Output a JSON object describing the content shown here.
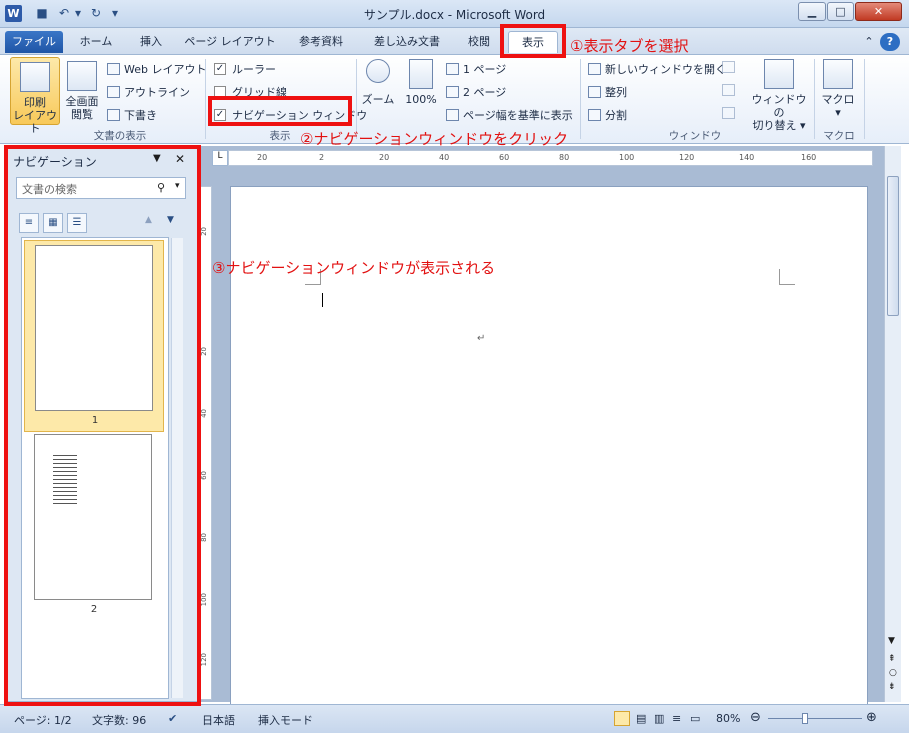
{
  "window": {
    "title": "サンプル.docx - Microsoft Word"
  },
  "tabs": [
    "ファイル",
    "ホーム",
    "挿入",
    "ページ レイアウト",
    "参考資料",
    "差し込み文書",
    "校閲",
    "表示"
  ],
  "ribbon": {
    "doc_view": {
      "print_layout_1": "印刷",
      "print_layout_2": "レイアウト",
      "full_screen_1": "全画面",
      "full_screen_2": "閲覧",
      "web_layout": "Web レイアウト",
      "outline": "アウトライン",
      "draft": "下書き",
      "label": "文書の表示"
    },
    "show": {
      "ruler": "ルーラー",
      "gridlines": "グリッド線",
      "nav_pane": "ナビゲーション ウィンドウ",
      "label": "表示"
    },
    "zoom": {
      "zoom": "ズーム",
      "hundred": "100%",
      "one_page": "1 ページ",
      "two_pages": "2 ページ",
      "page_width": "ページ幅を基準に表示"
    },
    "window": {
      "new_window": "新しいウィンドウを開く",
      "arrange": "整列",
      "split": "分割",
      "switch_1": "ウィンドウの",
      "switch_2": "切り替え ▾",
      "label": "ウィンドウ"
    },
    "macro": {
      "macro": "マクロ",
      "label": "マクロ"
    }
  },
  "nav_pane": {
    "title": "ナビゲーション",
    "search_placeholder": "文書の検索",
    "page1": "1",
    "page2": "2"
  },
  "ruler_labels": [
    "20",
    "2",
    "20",
    "40",
    "60",
    "80",
    "100",
    "120",
    "140",
    "160"
  ],
  "vruler_labels": [
    "20",
    "20",
    "40",
    "60",
    "80",
    "100",
    "120"
  ],
  "status": {
    "page": "ページ: 1/2",
    "words": "文字数: 96",
    "lang": "日本語",
    "mode": "挿入モード",
    "zoom": "80%"
  },
  "annotations": {
    "step1": "①表示タブを選択",
    "step2": "②ナビゲーションウィンドウをクリック",
    "step3": "③ナビゲーションウィンドウが表示される"
  },
  "colors": {
    "annotation": "#ee1111",
    "highlight": "#fde9a9"
  }
}
